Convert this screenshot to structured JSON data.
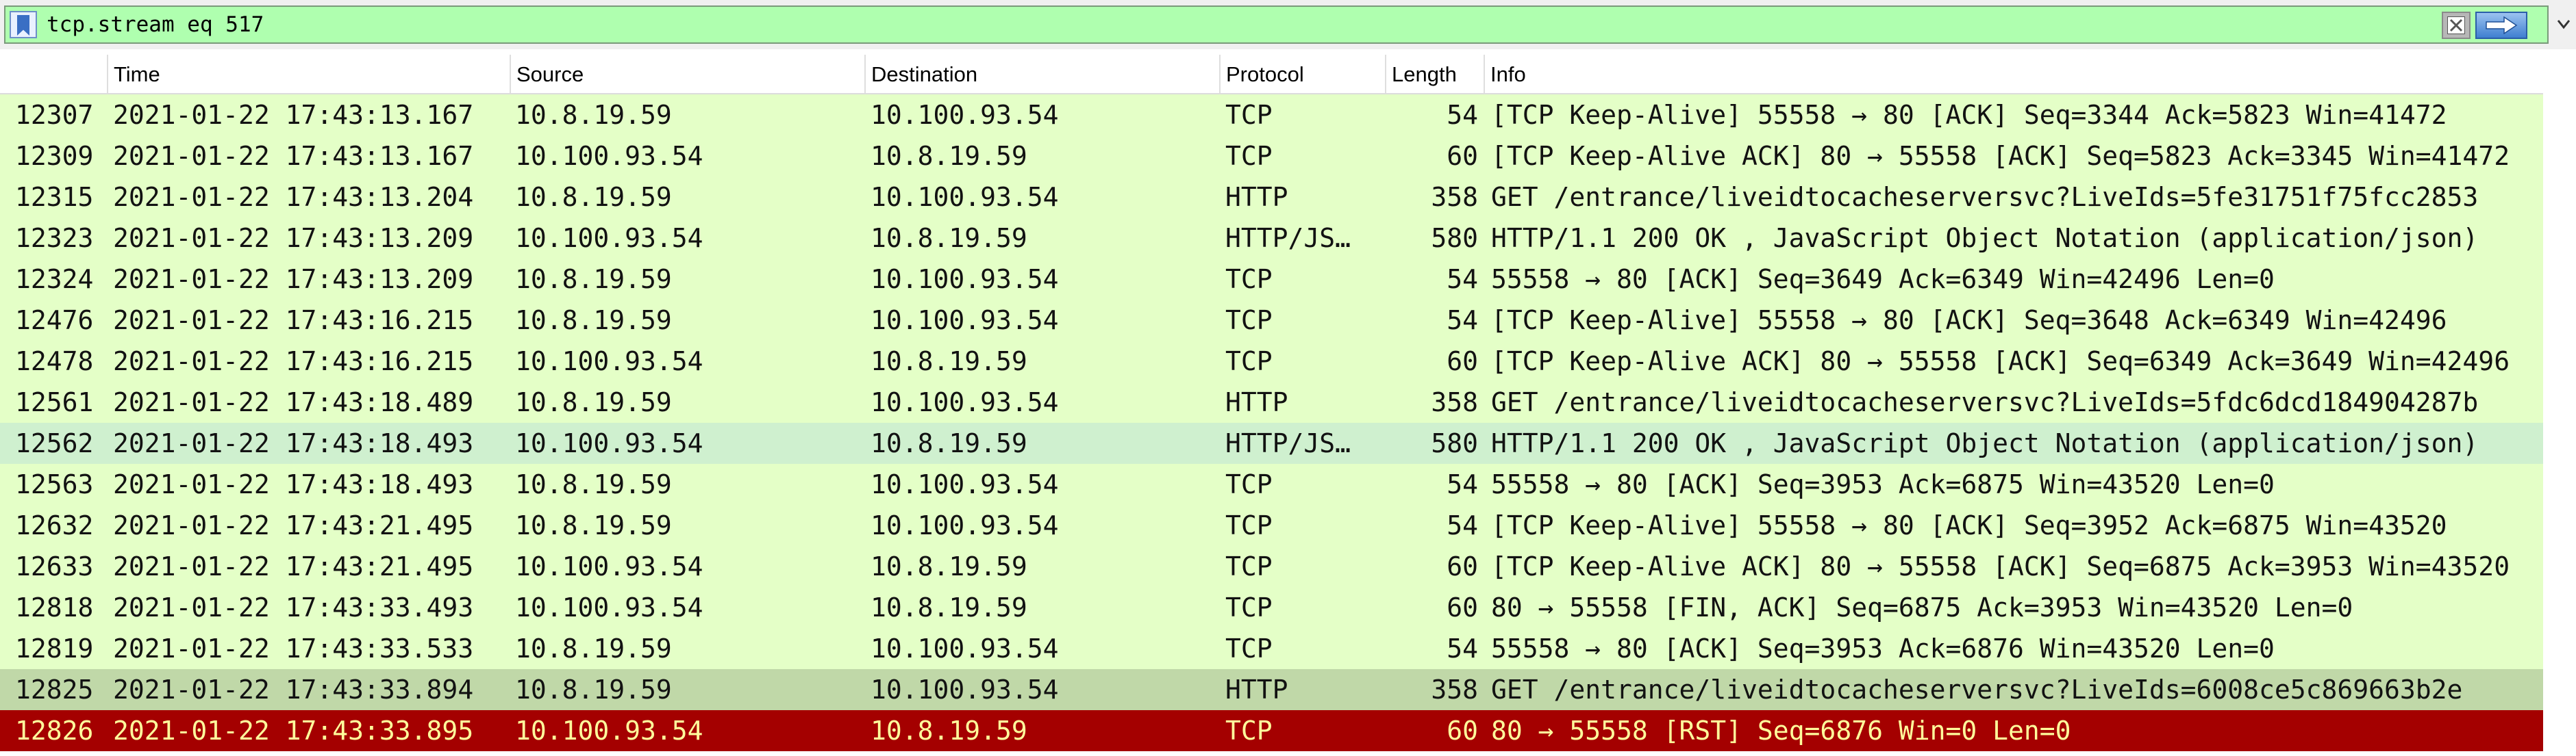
{
  "filter": {
    "value": "tcp.stream eq 517",
    "icons": {
      "bookmark": "bookmark-icon",
      "clear": "clear-x-icon",
      "apply": "arrow-right-icon",
      "dropdown": "chevron-down-icon"
    },
    "colors": {
      "valid_bg": "#afffaf"
    }
  },
  "columns": {
    "no": "",
    "time": "Time",
    "source": "Source",
    "destination": "Destination",
    "protocol": "Protocol",
    "length": "Length",
    "info": "Info"
  },
  "colors": {
    "tcp_row": "#e4ffc7",
    "rst_row_bg": "#a40000",
    "rst_row_fg": "#fffc9c"
  },
  "packets": [
    {
      "no": "12307",
      "time": "2021-01-22 17:43:13.167",
      "src": "10.8.19.59",
      "dst": "10.100.93.54",
      "proto": "TCP",
      "len": "54",
      "info": "[TCP Keep-Alive] 55558 → 80 [ACK] Seq=3344 Ack=5823 Win=41472"
    },
    {
      "no": "12309",
      "time": "2021-01-22 17:43:13.167",
      "src": "10.100.93.54",
      "dst": "10.8.19.59",
      "proto": "TCP",
      "len": "60",
      "info": "[TCP Keep-Alive ACK] 80 → 55558 [ACK] Seq=5823 Ack=3345 Win=41472"
    },
    {
      "no": "12315",
      "time": "2021-01-22 17:43:13.204",
      "src": "10.8.19.59",
      "dst": "10.100.93.54",
      "proto": "HTTP",
      "len": "358",
      "info": "GET /entrance/liveidtocacheserversvc?LiveIds=5fe31751f75fcc2853"
    },
    {
      "no": "12323",
      "time": "2021-01-22 17:43:13.209",
      "src": "10.100.93.54",
      "dst": "10.8.19.59",
      "proto": "HTTP/JS…",
      "len": "580",
      "info": "HTTP/1.1 200 OK , JavaScript Object Notation (application/json)"
    },
    {
      "no": "12324",
      "time": "2021-01-22 17:43:13.209",
      "src": "10.8.19.59",
      "dst": "10.100.93.54",
      "proto": "TCP",
      "len": "54",
      "info": "55558 → 80 [ACK] Seq=3649 Ack=6349 Win=42496 Len=0"
    },
    {
      "no": "12476",
      "time": "2021-01-22 17:43:16.215",
      "src": "10.8.19.59",
      "dst": "10.100.93.54",
      "proto": "TCP",
      "len": "54",
      "info": "[TCP Keep-Alive] 55558 → 80 [ACK] Seq=3648 Ack=6349 Win=42496"
    },
    {
      "no": "12478",
      "time": "2021-01-22 17:43:16.215",
      "src": "10.100.93.54",
      "dst": "10.8.19.59",
      "proto": "TCP",
      "len": "60",
      "info": "[TCP Keep-Alive ACK] 80 → 55558 [ACK] Seq=6349 Ack=3649 Win=42496"
    },
    {
      "no": "12561",
      "time": "2021-01-22 17:43:18.489",
      "src": "10.8.19.59",
      "dst": "10.100.93.54",
      "proto": "HTTP",
      "len": "358",
      "info": "GET /entrance/liveidtocacheserversvc?LiveIds=5fdc6dcd184904287b"
    },
    {
      "no": "12562",
      "time": "2021-01-22 17:43:18.493",
      "src": "10.100.93.54",
      "dst": "10.8.19.59",
      "proto": "HTTP/JS…",
      "len": "580",
      "info": "HTTP/1.1 200 OK , JavaScript Object Notation (application/json)"
    },
    {
      "no": "12563",
      "time": "2021-01-22 17:43:18.493",
      "src": "10.8.19.59",
      "dst": "10.100.93.54",
      "proto": "TCP",
      "len": "54",
      "info": "55558 → 80 [ACK] Seq=3953 Ack=6875 Win=43520 Len=0"
    },
    {
      "no": "12632",
      "time": "2021-01-22 17:43:21.495",
      "src": "10.8.19.59",
      "dst": "10.100.93.54",
      "proto": "TCP",
      "len": "54",
      "info": "[TCP Keep-Alive] 55558 → 80 [ACK] Seq=3952 Ack=6875 Win=43520"
    },
    {
      "no": "12633",
      "time": "2021-01-22 17:43:21.495",
      "src": "10.100.93.54",
      "dst": "10.8.19.59",
      "proto": "TCP",
      "len": "60",
      "info": "[TCP Keep-Alive ACK] 80 → 55558 [ACK] Seq=6875 Ack=3953 Win=43520"
    },
    {
      "no": "12818",
      "time": "2021-01-22 17:43:33.493",
      "src": "10.100.93.54",
      "dst": "10.8.19.59",
      "proto": "TCP",
      "len": "60",
      "info": "80 → 55558 [FIN, ACK] Seq=6875 Ack=3953 Win=43520 Len=0"
    },
    {
      "no": "12819",
      "time": "2021-01-22 17:43:33.533",
      "src": "10.8.19.59",
      "dst": "10.100.93.54",
      "proto": "TCP",
      "len": "54",
      "info": "55558 → 80 [ACK] Seq=3953 Ack=6876 Win=43520 Len=0"
    },
    {
      "no": "12825",
      "time": "2021-01-22 17:43:33.894",
      "src": "10.8.19.59",
      "dst": "10.100.93.54",
      "proto": "HTTP",
      "len": "358",
      "info": "GET /entrance/liveidtocacheserversvc?LiveIds=6008ce5c869663b2e"
    },
    {
      "no": "12826",
      "time": "2021-01-22 17:43:33.895",
      "src": "10.100.93.54",
      "dst": "10.8.19.59",
      "proto": "TCP",
      "len": "60",
      "info": "80 → 55558 [RST] Seq=6876 Win=0 Len=0"
    }
  ]
}
